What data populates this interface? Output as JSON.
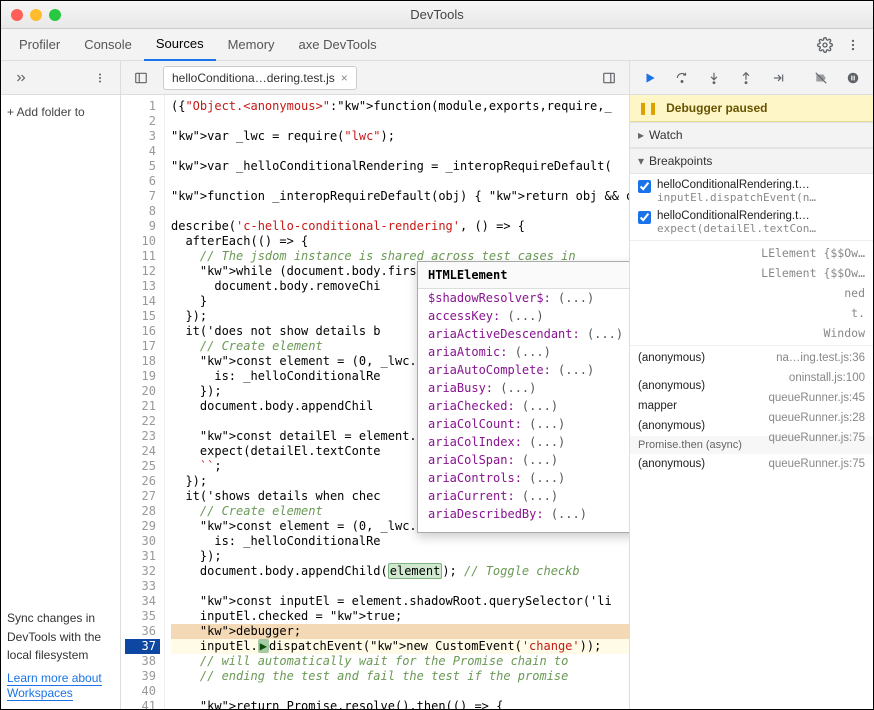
{
  "window": {
    "title": "DevTools"
  },
  "tabs": {
    "items": [
      "Profiler",
      "Console",
      "Sources",
      "Memory",
      "axe DevTools"
    ],
    "activeIndex": 2
  },
  "fileTab": {
    "name": "helloConditiona…dering.test.js"
  },
  "navigator": {
    "addFolder": "+ Add folder to",
    "syncText": "Sync changes in DevTools with the local filesystem",
    "learnMore": "Learn more about",
    "workspaces": "Workspaces"
  },
  "code": {
    "lines": [
      "({\"Object.<anonymous>\":function(module,exports,require,_",
      "",
      "var _lwc = require(\"lwc\");",
      "",
      "var _helloConditionalRendering = _interopRequireDefault(",
      "",
      "function _interopRequireDefault(obj) { return obj && obj",
      "",
      "describe('c-hello-conditional-rendering', () => {",
      "  afterEach(() => {",
      "    // The jsdom instance is shared across test cases in",
      "    while (document.body.firs",
      "      document.body.removeChi",
      "    }",
      "  });",
      "  it('does not show details b",
      "    // Create element",
      "    const element = (0, _lwc.",
      "      is: _helloConditionalRe",
      "    });",
      "    document.body.appendChil",
      "",
      "    const detailEl = element.",
      "    expect(detailEl.textConte",
      "    ``;",
      "  });",
      "  it('shows details when chec",
      "    // Create element",
      "    const element = (0, _lwc.",
      "      is: _helloConditionalRe",
      "    });",
      "    document.body.appendChild(element); // Toggle checkb",
      "",
      "    const inputEl = element.shadowRoot.querySelector('li",
      "    inputEl.checked = true;",
      "    debugger;",
      "    inputEl.dispatchEvent(new CustomEvent('change'));",
      "    // will automatically wait for the Promise chain to",
      "    // ending the test and fail the test if the promise",
      "",
      "    return Promise.resolve().then(() => {"
    ],
    "firstLine": 1,
    "executionLine": 37,
    "tokenHighlight": "element"
  },
  "tooltip": {
    "header": "HTMLElement",
    "props": [
      "$shadowResolver$: (...)",
      "accessKey: (...)",
      "ariaActiveDescendant: (...)",
      "ariaAtomic: (...)",
      "ariaAutoComplete: (...)",
      "ariaBusy: (...)",
      "ariaChecked: (...)",
      "ariaColCount: (...)",
      "ariaColIndex: (...)",
      "ariaColSpan: (...)",
      "ariaControls: (...)",
      "ariaCurrent: (...)",
      "ariaDescribedBy: (...)"
    ]
  },
  "debugger": {
    "banner": "Debugger paused",
    "watch": "Watch",
    "breakpoints": {
      "title": "Breakpoints",
      "items": [
        {
          "label": "helloConditionalRendering.t…",
          "preview": "inputEl.dispatchEvent(n…",
          "checked": true
        },
        {
          "label": "helloConditionalRendering.t…",
          "preview": "expect(detailEl.textCon…",
          "checked": true
        }
      ]
    },
    "scope": [
      {
        "name": "",
        "type": "LElement {$$Ow…"
      },
      {
        "name": "",
        "type": "LElement {$$Ow…"
      },
      {
        "name": "",
        "type": "ned"
      },
      {
        "name": "",
        "type": "t."
      },
      {
        "name": "",
        "type": "Window"
      }
    ],
    "callstack": [
      {
        "fn": "(anonymous)",
        "loc": "na…ing.test.js:36"
      },
      {
        "fn": "",
        "loc": "oninstall.js:100",
        "async": false
      },
      {
        "fn": "(anonymous)",
        "loc": "queueRunner.js:45"
      },
      {
        "fn": "mapper",
        "loc": "queueRunner.js:28"
      },
      {
        "fn": "(anonymous)",
        "loc": "queueRunner.js:75"
      },
      {
        "fn": "Promise.then (async)",
        "loc": "",
        "async": true
      },
      {
        "fn": "(anonymous)",
        "loc": "queueRunner.js:75"
      }
    ]
  }
}
